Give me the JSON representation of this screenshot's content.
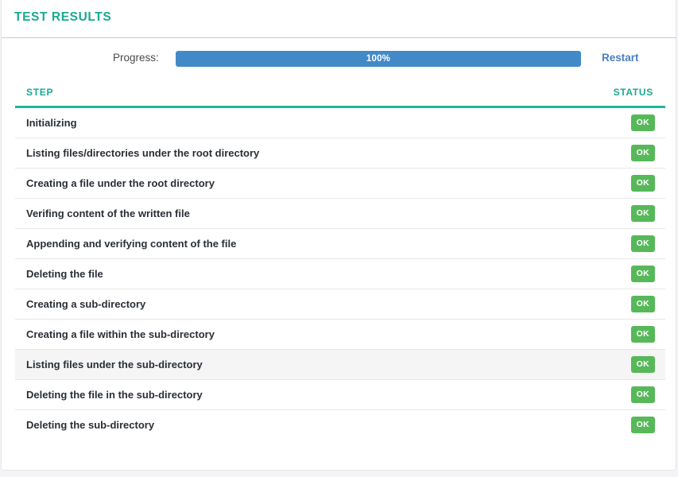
{
  "header": {
    "title": "TEST RESULTS",
    "accent_color": "#1aa98f"
  },
  "progress": {
    "label": "Progress:",
    "percent_text": "100%",
    "percent_value": 100,
    "bar_color": "#4189c7",
    "restart_label": "Restart",
    "restart_color": "#4a7fc1"
  },
  "table": {
    "columns": {
      "step": "STEP",
      "status": "STATUS"
    },
    "header_underline_color": "#1fb89c",
    "status_badge_color": "#57b85a",
    "rows": [
      {
        "step": "Initializing",
        "status": "OK",
        "highlighted": false
      },
      {
        "step": "Listing files/directories under the root directory",
        "status": "OK",
        "highlighted": false
      },
      {
        "step": "Creating a file under the root directory",
        "status": "OK",
        "highlighted": false
      },
      {
        "step": "Verifing content of the written file",
        "status": "OK",
        "highlighted": false
      },
      {
        "step": "Appending and verifying content of the file",
        "status": "OK",
        "highlighted": false
      },
      {
        "step": "Deleting the file",
        "status": "OK",
        "highlighted": false
      },
      {
        "step": "Creating a sub-directory",
        "status": "OK",
        "highlighted": false
      },
      {
        "step": "Creating a file within the sub-directory",
        "status": "OK",
        "highlighted": false
      },
      {
        "step": "Listing files under the sub-directory",
        "status": "OK",
        "highlighted": true
      },
      {
        "step": "Deleting the file in the sub-directory",
        "status": "OK",
        "highlighted": false
      },
      {
        "step": "Deleting the sub-directory",
        "status": "OK",
        "highlighted": false
      }
    ]
  }
}
